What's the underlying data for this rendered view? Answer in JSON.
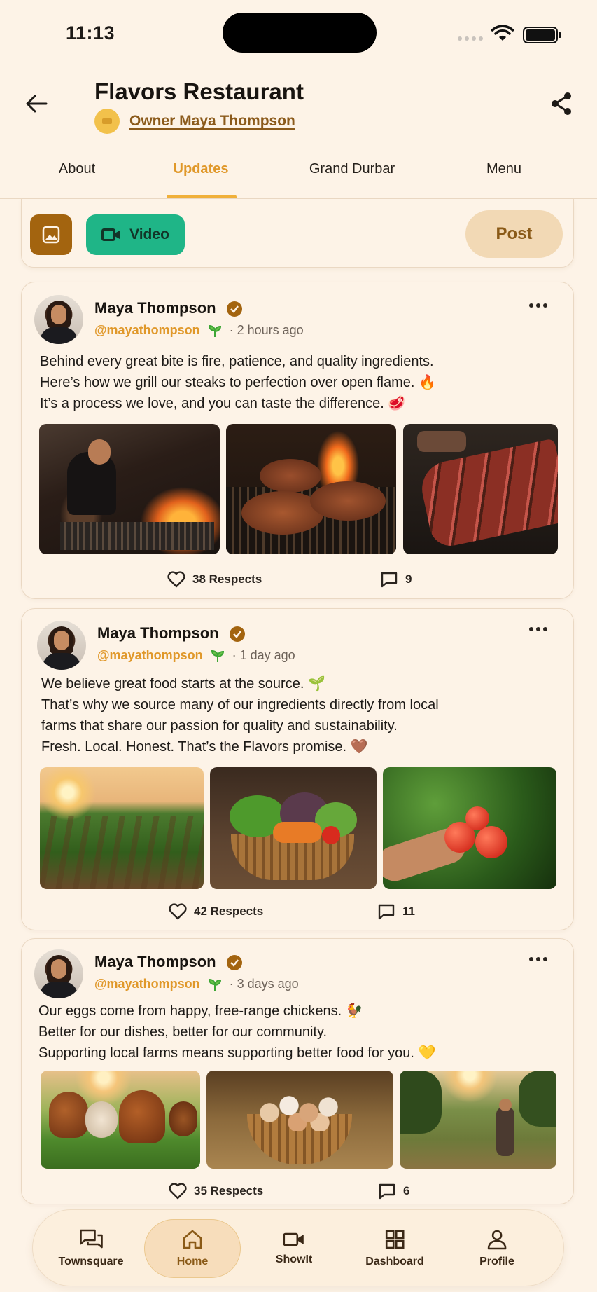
{
  "status_bar": {
    "time": "11:13"
  },
  "header": {
    "title": "Flavors Restaurant",
    "owner_label": "Owner Maya Thompson"
  },
  "tabs": [
    {
      "label": "About",
      "active": false
    },
    {
      "label": "Updates",
      "active": true
    },
    {
      "label": "Grand Durbar",
      "active": false
    },
    {
      "label": "Menu",
      "active": false
    }
  ],
  "composer": {
    "video_label": "Video",
    "post_label": "Post"
  },
  "posts": [
    {
      "author": "Maya Thompson",
      "handle": "@mayathompson",
      "time": "· 2 hours ago",
      "text": "Behind every great bite is fire, patience, and quality ingredients.\nHere’s how we grill our steaks to perfection over open flame.  🔥\nIt’s a process we love, and you can taste the difference.  🥩",
      "respects": "38 Respects",
      "comments": "9"
    },
    {
      "author": "Maya Thompson",
      "handle": "@mayathompson",
      "time": "· 1 day ago",
      "text": "We believe great food starts at the source.  🌱\nThat’s why we source many of our ingredients directly from local\nfarms that share our passion for quality and sustainability.\nFresh. Local. Honest. That’s the Flavors promise.  🤎",
      "respects": "42 Respects",
      "comments": "11"
    },
    {
      "author": "Maya Thompson",
      "handle": "@mayathompson",
      "time": "· 3 days ago",
      "text": "Our eggs come from happy, free-range chickens.  🐓\nBetter for our dishes, better for our community.\nSupporting local farms means supporting better food for you.  💛",
      "respects": "35 Respects",
      "comments": "6"
    }
  ],
  "bottom_nav": [
    {
      "label": "Townsquare",
      "icon": "chat-bubbles-icon"
    },
    {
      "label": "Home",
      "icon": "home-icon",
      "active": true
    },
    {
      "label": "ShowIt",
      "icon": "video-camera-icon"
    },
    {
      "label": "Dashboard",
      "icon": "grid-icon"
    },
    {
      "label": "Profile",
      "icon": "person-icon"
    }
  ],
  "colors": {
    "background": "#fdf3e7",
    "accent": "#e0982a",
    "brown": "#a3640f",
    "green": "#1fb587"
  }
}
